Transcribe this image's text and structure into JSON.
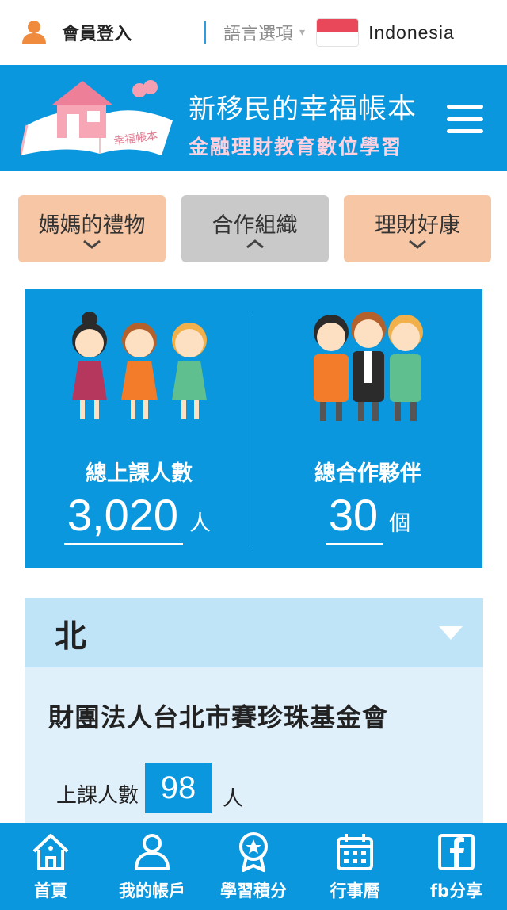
{
  "topbar": {
    "login_label": "會員登入",
    "language_label": "語言選項",
    "language_caret": "▾",
    "language_name": "Indonesia",
    "flag_colors": [
      "#e8485a",
      "#ffffff"
    ]
  },
  "header": {
    "brand_prefix": "新移民的",
    "brand_main": "幸福帳本",
    "brand_sub": "金融理財教育數位學習",
    "logo_book_text": "幸福帳本"
  },
  "tabs": [
    {
      "label": "媽媽的禮物",
      "chevron": "⌄",
      "color": "#f7c7a5"
    },
    {
      "label": "合作組織",
      "chevron": "⌃",
      "color": "#c9c9c9"
    },
    {
      "label": "理財好康",
      "chevron": "⌄",
      "color": "#f7c7a5"
    }
  ],
  "stats": {
    "students": {
      "label": "總上課人數",
      "value": "3,020",
      "unit": "人"
    },
    "partners": {
      "label": "總合作夥伴",
      "value": "30",
      "unit": "個"
    }
  },
  "region": {
    "title": "北",
    "org_name": "財團法人台北市賽珍珠基金會",
    "count_label": "上課人數",
    "count_value": "98",
    "count_unit": "人"
  },
  "bottom_nav": [
    {
      "label": "首頁",
      "icon": "home-icon"
    },
    {
      "label": "我的帳戶",
      "icon": "user-icon"
    },
    {
      "label": "學習積分",
      "icon": "award-icon"
    },
    {
      "label": "行事曆",
      "icon": "calendar-icon"
    },
    {
      "label": "fb分享",
      "icon": "facebook-icon"
    }
  ],
  "colors": {
    "primary": "#0b97de",
    "accordion_head": "#bfe3f7",
    "accordion_body": "#dff0fb",
    "tab_peach": "#f7c7a5",
    "tab_gray": "#c9c9c9",
    "user_icon": "#f08a3c"
  }
}
